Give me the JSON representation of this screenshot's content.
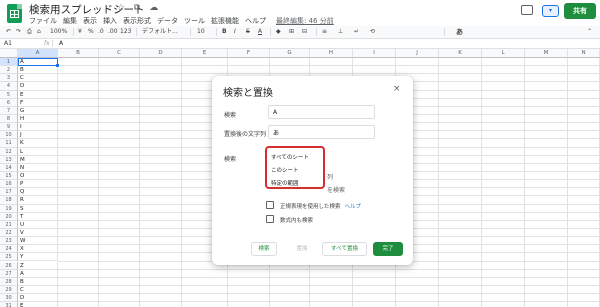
{
  "header": {
    "doc_title": "検索用スプレッドシート",
    "title_icons": "☆ ⧉ ☁",
    "menu": [
      "ファイル",
      "編集",
      "表示",
      "挿入",
      "表示形式",
      "データ",
      "ツール",
      "拡張機能",
      "ヘルプ"
    ],
    "last_edit": "最終編集: 46 分前",
    "share_label": "共有",
    "present_label": "▾"
  },
  "toolbar": {
    "undo": "↶",
    "redo": "↷",
    "print": "⎙",
    "paint": "⌂",
    "zoom": "100%",
    "currency": "¥",
    "percent": "%",
    "dec_less": ".0",
    "dec_more": ".00",
    "format_more": "123",
    "font": "デフォルト...",
    "font_size": "10",
    "bold": "B",
    "italic": "I",
    "strike": "S",
    "text_color": "A",
    "fill": "◆",
    "borders": "⊞",
    "merge": "⊟",
    "align": "≡",
    "valign": "⊥",
    "wrap": "↵",
    "rotate": "⟲",
    "more": "あ",
    "collapse": "⌃"
  },
  "formula_bar": {
    "cell_ref": "A1",
    "fx": "fx",
    "value": "A"
  },
  "grid": {
    "columns": [
      "A",
      "B",
      "C",
      "D",
      "E",
      "F",
      "G",
      "H",
      "I",
      "J",
      "K",
      "L",
      "M",
      "N"
    ],
    "rows": [
      "1",
      "2",
      "3",
      "4",
      "5",
      "6",
      "7",
      "8",
      "9",
      "10",
      "11",
      "12",
      "13",
      "14",
      "15",
      "16",
      "17",
      "18",
      "19",
      "20",
      "21",
      "22",
      "23",
      "24",
      "25",
      "26",
      "27",
      "28",
      "29",
      "30",
      "31"
    ],
    "col_a_values": [
      "A",
      "B",
      "C",
      "D",
      "E",
      "F",
      "G",
      "H",
      "I",
      "J",
      "K",
      "L",
      "M",
      "N",
      "O",
      "P",
      "Q",
      "R",
      "S",
      "T",
      "U",
      "V",
      "W",
      "X",
      "Y",
      "Z",
      "A",
      "B",
      "C",
      "D",
      "E"
    ]
  },
  "dialog": {
    "title": "検索と置換",
    "close": "×",
    "search_label": "検索",
    "search_value": "A",
    "replace_label": "置換後の文字列",
    "replace_value": "あ",
    "scope_label": "検索",
    "scope_options": [
      "すべてのシート",
      "このシート",
      "特定の範囲"
    ],
    "hidden_option_1": "列",
    "hidden_option_2": "を検索",
    "regex_label": "正規表現を使用した検索",
    "help_link": "ヘルプ",
    "formula_label": "数式内も検索",
    "buttons": {
      "find": "検索",
      "replace": "置換",
      "replace_all": "すべて置換",
      "done": "完了"
    }
  }
}
